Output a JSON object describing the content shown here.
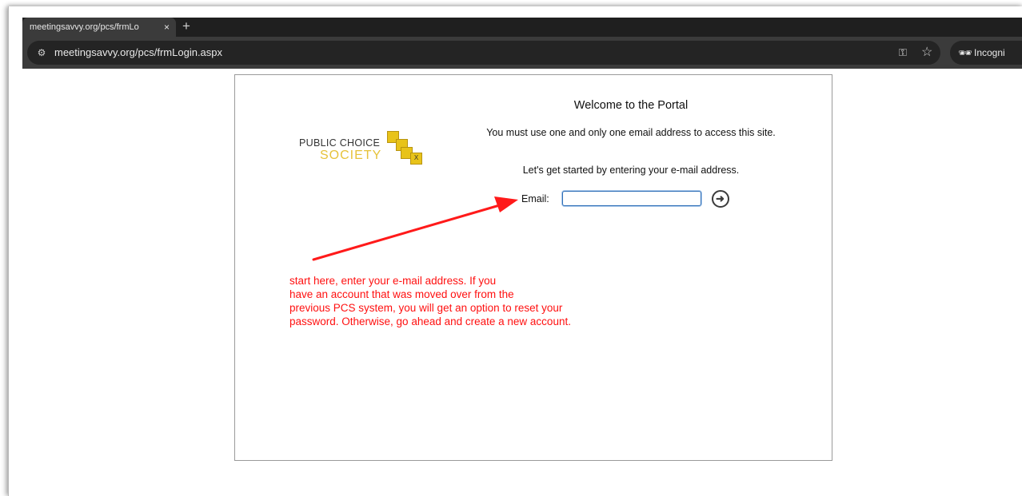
{
  "browser": {
    "tab_title": "meetingsavvy.org/pcs/frmLo",
    "tab_close": "×",
    "new_tab": "+",
    "url": "meetingsavvy.org/pcs/frmLogin.aspx",
    "incognito_label": "Incogni",
    "icons": {
      "site_info": "tune-icon",
      "password": "key-icon",
      "bookmark": "star-icon",
      "incognito": "incognito-icon"
    }
  },
  "logo": {
    "line1": "PUBLIC CHOICE",
    "line2": "SOCIETY",
    "cube_mark": "X",
    "colors": {
      "gold": "#e8c31a",
      "text": "#333333"
    }
  },
  "portal": {
    "title": "Welcome to the Portal",
    "instruction_1": "You must use one and only one email address to access this site.",
    "instruction_2": "Let's get started by entering your e-mail address.",
    "email_label": "Email:",
    "email_value": "",
    "go_icon": "arrow-right-circle-icon"
  },
  "annotation": {
    "color": "#ff1010",
    "lines": [
      "start here, enter your e-mail address.   If you",
      "have an account that was moved over from the",
      "previous PCS system, you will get an option to reset your",
      "password.  Otherwise, go ahead and create a new account."
    ]
  }
}
